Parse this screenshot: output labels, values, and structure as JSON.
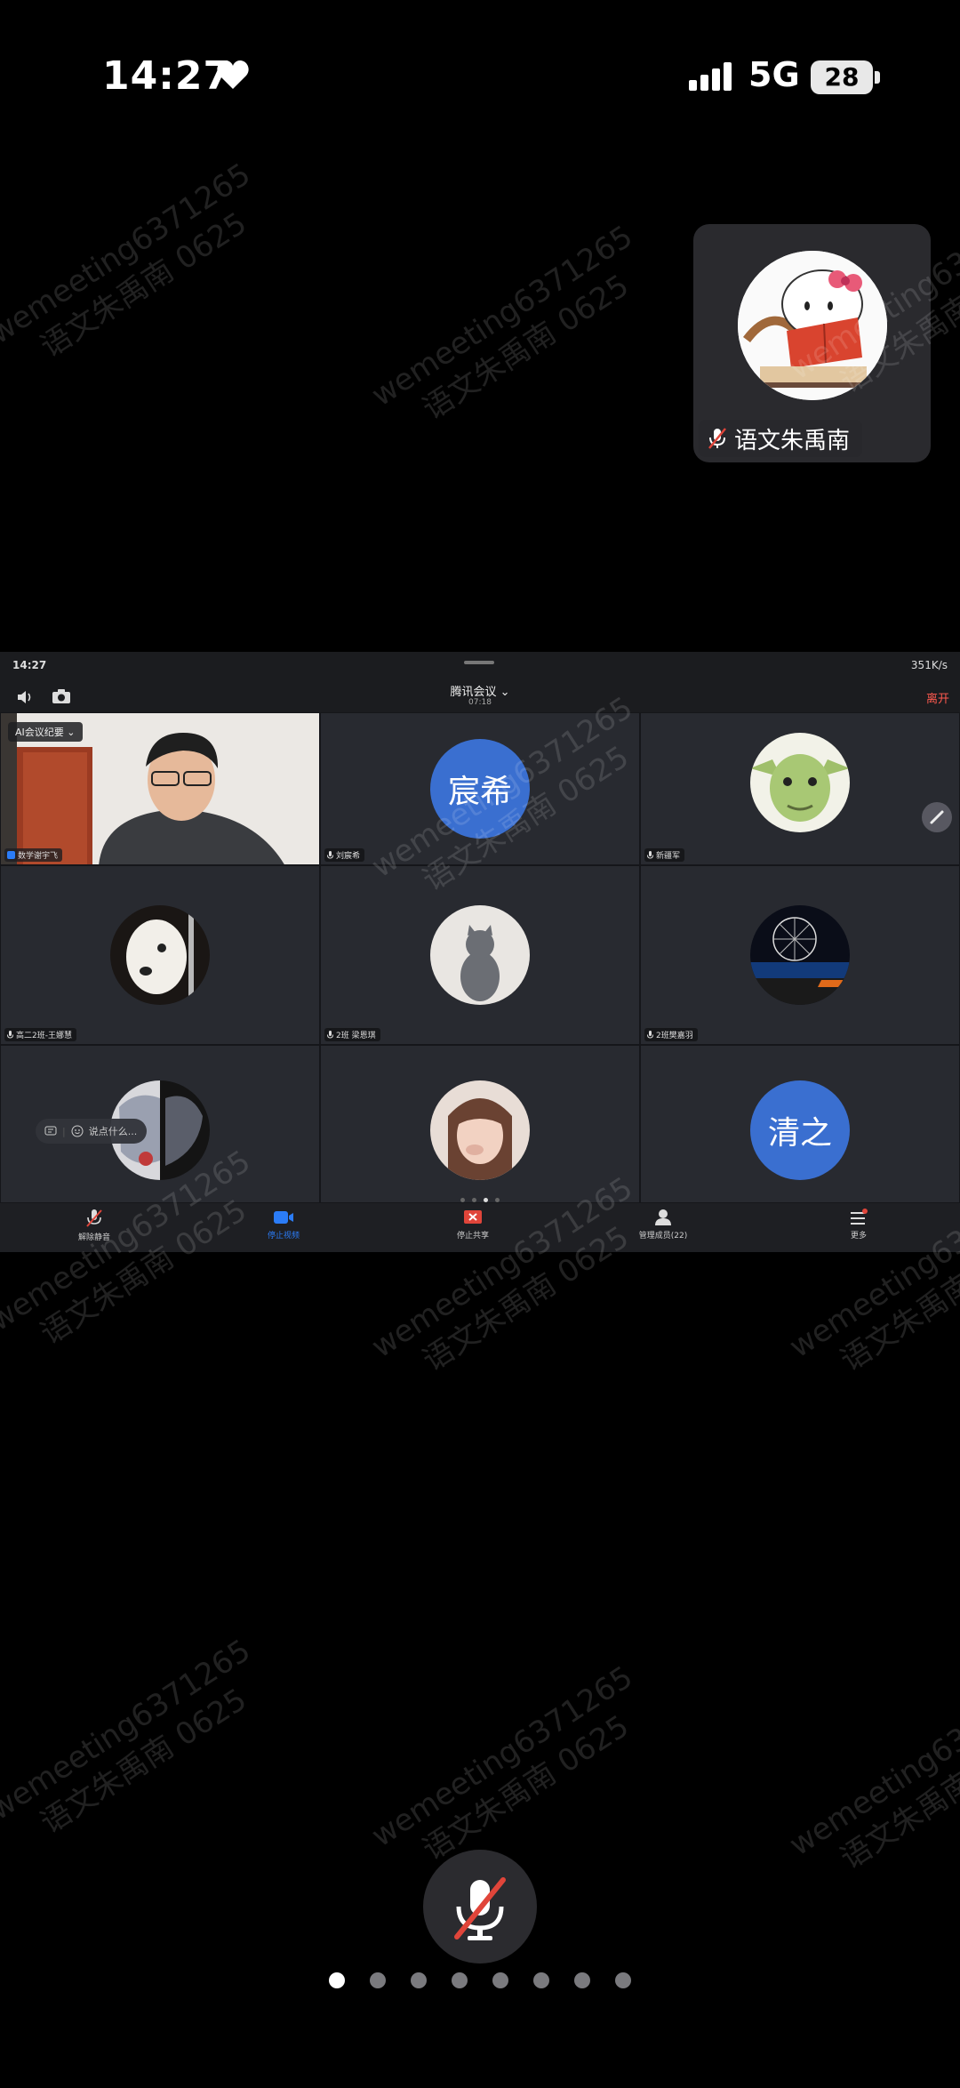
{
  "status_bar": {
    "time": "14:27",
    "network": "5G",
    "battery": "28"
  },
  "self_tile": {
    "name": "语文朱禹南"
  },
  "shared_screen": {
    "status_time": "14:27",
    "status_right": "351K/s",
    "meeting_title": "腾讯会议",
    "meeting_timer": "07:18",
    "leave_label": "离开",
    "ai_badge": "AI会议纪要",
    "chat_placeholder": "说点什么...",
    "participants": [
      {
        "name": "数学谢宇飞",
        "kind": "video"
      },
      {
        "name": "刘宸希",
        "avatar_text": "宸希",
        "kind": "text"
      },
      {
        "name": "新疆军",
        "kind": "image"
      },
      {
        "name": "高二2班-王娜慧",
        "kind": "image"
      },
      {
        "name": "2班 梁恩琪",
        "kind": "image"
      },
      {
        "name": "2班樊嘉羽",
        "kind": "image"
      },
      {
        "name": "",
        "kind": "image"
      },
      {
        "name": "",
        "kind": "image"
      },
      {
        "name": "",
        "avatar_text": "清之",
        "kind": "text"
      }
    ],
    "bottom_bar": [
      {
        "label": "解除静音"
      },
      {
        "label": "停止视频"
      },
      {
        "label": "停止共享"
      },
      {
        "label": "管理成员(22)"
      },
      {
        "label": "更多"
      }
    ]
  },
  "watermark": {
    "line1": "wemeeting6371265",
    "line2": "语文朱禹南 0625"
  },
  "colors": {
    "accent": "#2b7cf7",
    "leave": "#ff5a4f",
    "avatar_blue": "#3a6fd0",
    "mute_red": "#e0453a"
  }
}
